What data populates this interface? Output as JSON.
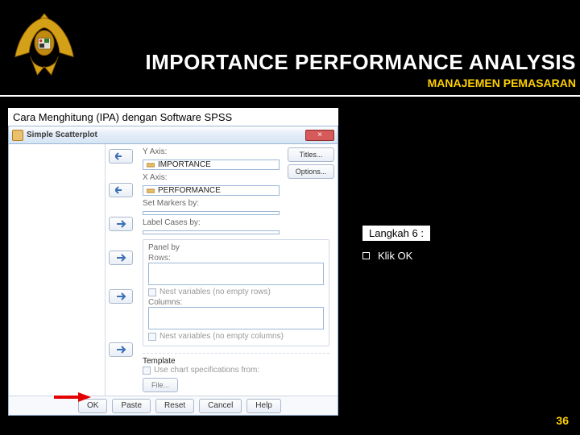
{
  "header": {
    "title": "IMPORTANCE PERFORMANCE ANALYSIS",
    "subtitle": "MANAJEMEN PEMASARAN"
  },
  "caption": "Cara Menghitung (IPA) dengan Software SPSS",
  "dialog": {
    "window_title": "Simple Scatterplot",
    "close_glyph": "×",
    "side": {
      "titles": "Titles...",
      "options": "Options..."
    },
    "yaxis": {
      "label": "Y Axis:",
      "value": "IMPORTANCE"
    },
    "xaxis": {
      "label": "X Axis:",
      "value": "PERFORMANCE"
    },
    "markers": {
      "label": "Set Markers by:"
    },
    "labelcases": {
      "label": "Label Cases by:"
    },
    "panel": {
      "group": "Panel by",
      "rows": "Rows:",
      "rows_nest": "Nest variables (no empty rows)",
      "cols": "Columns:",
      "cols_nest": "Nest variables (no empty columns)"
    },
    "template": {
      "group": "Template",
      "use_spec": "Use chart specifications from:",
      "file": "File..."
    },
    "buttons": {
      "ok": "OK",
      "paste": "Paste",
      "reset": "Reset",
      "cancel": "Cancel",
      "help": "Help"
    }
  },
  "instructions": {
    "step": "Langkah 6 :",
    "item1": "Klik OK"
  },
  "page_number": "36"
}
